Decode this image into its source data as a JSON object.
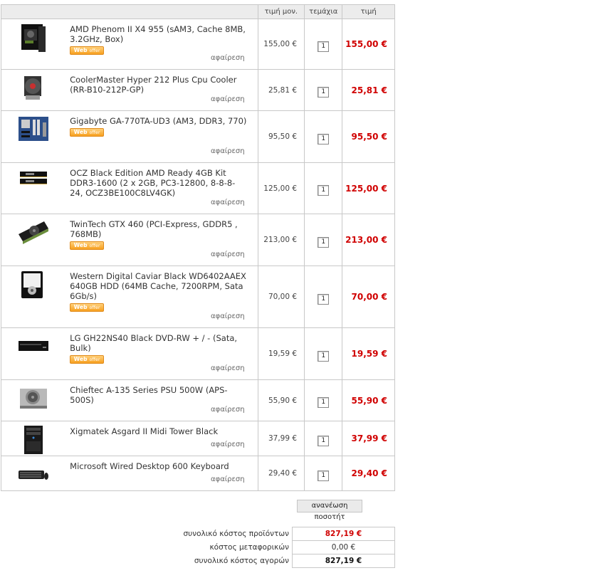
{
  "cart": {
    "headers": {
      "unit_price": "τιμή μον.",
      "quantity": "τεμάχια",
      "price": "τιμή"
    },
    "remove_label": "αφαίρεση",
    "web_offer_badge": {
      "web": "Web",
      "offer": "offer"
    },
    "items": [
      {
        "name": "AMD Phenom II X4 955 (sAM3, Cache 8MB, 3.2GHz, Box)",
        "web_offer": true,
        "unit_price": "155,00 €",
        "qty": "1",
        "total": "155,00 €",
        "icon": "cpu-box-icon"
      },
      {
        "name": "CoolerMaster Hyper 212 Plus Cpu Cooler (RR-B10-212P-GP)",
        "web_offer": false,
        "unit_price": "25,81 €",
        "qty": "1",
        "total": "25,81 €",
        "icon": "cpu-cooler-icon"
      },
      {
        "name": "Gigabyte GA-770TA-UD3 (AM3, DDR3, 770)",
        "web_offer": true,
        "unit_price": "95,50 €",
        "qty": "1",
        "total": "95,50 €",
        "icon": "motherboard-icon"
      },
      {
        "name": "OCZ Black Edition AMD Ready 4GB Kit DDR3-1600 (2 x 2GB, PC3-12800, 8-8-8-24, OCZ3BE100C8LV4GK)",
        "web_offer": false,
        "unit_price": "125,00 €",
        "qty": "1",
        "total": "125,00 €",
        "icon": "ram-icon"
      },
      {
        "name": "TwinTech GTX 460 (PCI-Express, GDDR5 , 768MB)",
        "web_offer": true,
        "unit_price": "213,00 €",
        "qty": "1",
        "total": "213,00 €",
        "icon": "graphics-card-icon"
      },
      {
        "name": "Western Digital Caviar Black WD6402AAEX 640GB HDD (64MB Cache, 7200RPM, Sata 6Gb/s)",
        "web_offer": true,
        "unit_price": "70,00 €",
        "qty": "1",
        "total": "70,00 €",
        "icon": "hard-drive-icon"
      },
      {
        "name": "LG GH22NS40 Black DVD-RW + / - (Sata, Bulk)",
        "web_offer": true,
        "unit_price": "19,59 €",
        "qty": "1",
        "total": "19,59 €",
        "icon": "dvd-drive-icon"
      },
      {
        "name": "Chieftec A-135 Series PSU 500W (APS-500S)",
        "web_offer": false,
        "unit_price": "55,90 €",
        "qty": "1",
        "total": "55,90 €",
        "icon": "power-supply-icon"
      },
      {
        "name": "Xigmatek Asgard II Midi Tower Black",
        "web_offer": false,
        "unit_price": "37,99 €",
        "qty": "1",
        "total": "37,99 €",
        "icon": "pc-case-icon"
      },
      {
        "name": "Microsoft Wired Desktop 600 Keyboard",
        "web_offer": false,
        "unit_price": "29,40 €",
        "qty": "1",
        "total": "29,40 €",
        "icon": "keyboard-icon"
      }
    ]
  },
  "update_button": "ανανέωση ποσοτήτ",
  "summary": {
    "products_label": "συνολικό κόστος προϊόντων",
    "products_value": "827,19 €",
    "shipping_label": "κόστος μεταφορικών",
    "shipping_value": "0,00 €",
    "grand_label": "συνολικό κόστος αγορών",
    "grand_value": "827,19 €"
  },
  "colors": {
    "price_red": "#d00000",
    "border": "#c8c8c8",
    "header_bg": "#ececec",
    "badge_orange": "#f7a020"
  }
}
